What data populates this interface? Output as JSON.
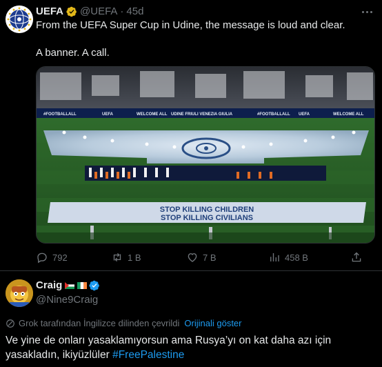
{
  "post1": {
    "author_name": "UEFA",
    "handle": "@UEFA",
    "separator": "·",
    "time": "45d",
    "text_line1": "From the UEFA Super Cup in Udine, the message is loud and clear.",
    "text_line2": "A banner. A call.",
    "media": {
      "banner_line1": "STOP KILLING CHILDREN",
      "banner_line2": "STOP KILLING CIVILIANS",
      "ad_boards": [
        "#FOOTBALLALL",
        "UEFA",
        "WELCOME ALL",
        "UDINE FRIULI VENEZIA GIULIA",
        "#FOOTBALLALL",
        "UEFA",
        "WELCOME ALL"
      ]
    },
    "actions": {
      "replies": "792",
      "reposts": "1 B",
      "likes": "7 B",
      "views": "458 B"
    }
  },
  "post2": {
    "author_name": "Craig",
    "handle": "@Nine9Craig",
    "translation_note": "Grok tarafından İngilizce dilinden çevrildi",
    "show_original": "Orijinali göster",
    "text_line1": "Ve yine de onları yasaklamıyorsun ama Rusya’yı on kat daha azı için",
    "text_line2_prefix": "yasakladın, ikiyüzlüler ",
    "hashtag": "#FreePalestine"
  },
  "colors": {
    "background": "#000000",
    "text": "#e7e9ea",
    "muted": "#71767b",
    "accent": "#1d9bf0",
    "verified_gold": "#e2b719",
    "divider": "#2f3336"
  },
  "icons": [
    "verified-gold-badge",
    "verified-blue-badge",
    "more-icon",
    "reply-icon",
    "repost-icon",
    "like-icon",
    "views-icon",
    "share-icon",
    "grok-icon"
  ]
}
